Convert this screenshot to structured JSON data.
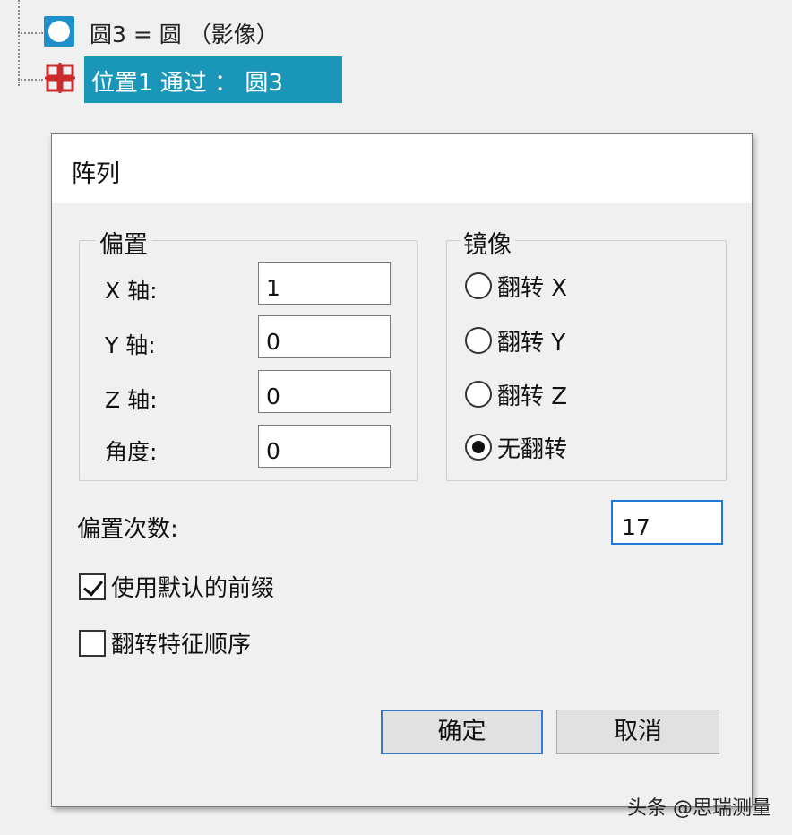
{
  "tree": {
    "items": [
      {
        "label": "圆3 = 圆 （影像）"
      },
      {
        "label": "位置1 通过 ： 圆3"
      }
    ]
  },
  "dialog": {
    "title": "阵列",
    "offset_group": {
      "title": "偏置",
      "rows": [
        {
          "label": "X 轴:",
          "value": "1"
        },
        {
          "label": "Y 轴:",
          "value": "0"
        },
        {
          "label": "Z 轴:",
          "value": "0"
        },
        {
          "label": "角度:",
          "value": "0"
        }
      ]
    },
    "mirror_group": {
      "title": "镜像",
      "options": [
        {
          "label": "翻转 X",
          "checked": false
        },
        {
          "label": "翻转 Y",
          "checked": false
        },
        {
          "label": "翻转 Z",
          "checked": false
        },
        {
          "label": "无翻转",
          "checked": true
        }
      ]
    },
    "offset_count": {
      "label": "偏置次数:",
      "value": "17"
    },
    "checkboxes": [
      {
        "label": "使用默认的前缀",
        "checked": true
      },
      {
        "label": "翻转特征顺序",
        "checked": false
      }
    ],
    "buttons": {
      "ok": "确定",
      "cancel": "取消"
    }
  },
  "watermark": "头条 @思瑞测量",
  "colors": {
    "selection": "#1a97b8",
    "circle_icon": "#1e8fc8",
    "pattern_icon": "#cc2b2b",
    "focus": "#1e78d6"
  }
}
